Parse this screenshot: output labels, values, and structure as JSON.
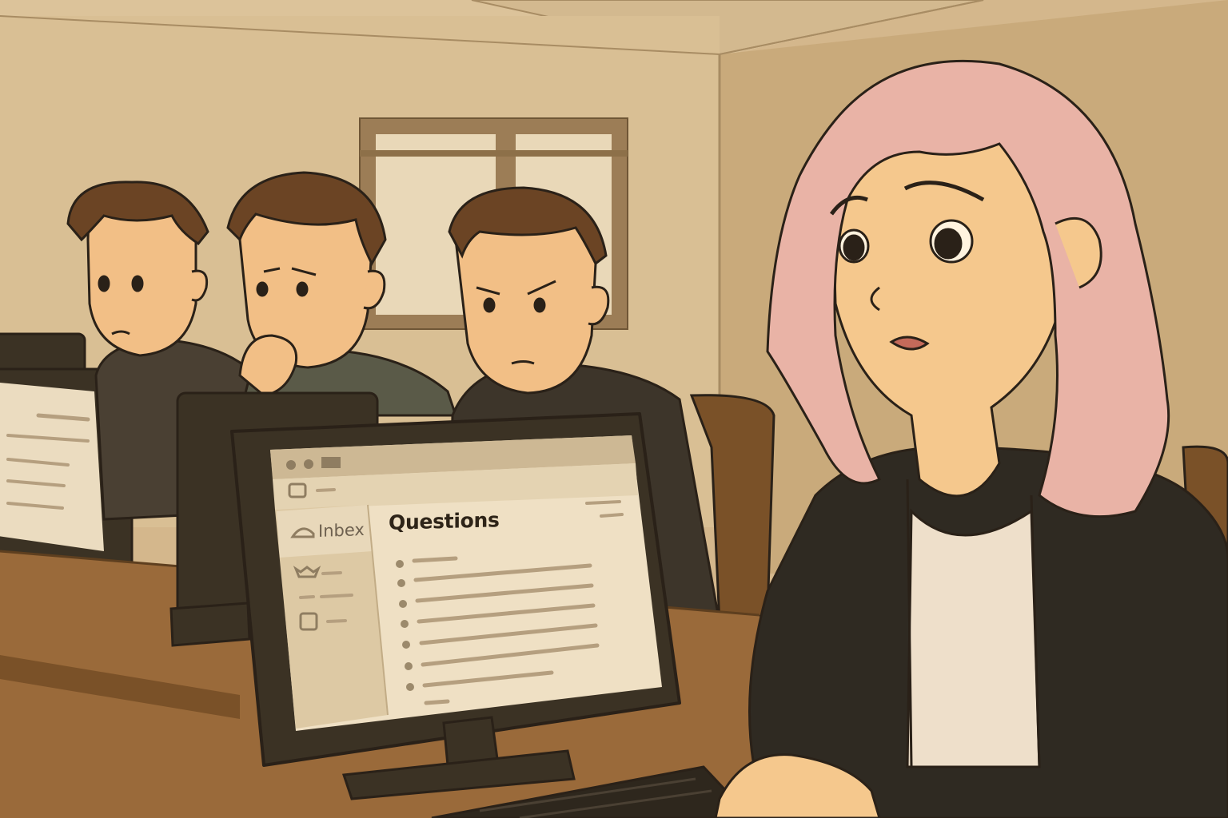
{
  "monitor_ui": {
    "sidebar_label": "Inbex",
    "main_title": "Questions"
  },
  "palette": {
    "wall": "#d9bf94",
    "wall_shadow": "#c9aa7b",
    "ceiling": "#dcc39a",
    "desk": "#9a6a3a",
    "desk_dark": "#7a5128",
    "monitor_frame": "#3b3224",
    "screen": "#efe0c4",
    "screen_sidebar": "#ddc9a4",
    "hair_brown": "#6b4424",
    "hair_pink": "#e9b3a6",
    "skin": "#f2bf86",
    "shirt_dark": "#3d352a",
    "jacket": "#2f2a22",
    "line": "#2a2118"
  }
}
